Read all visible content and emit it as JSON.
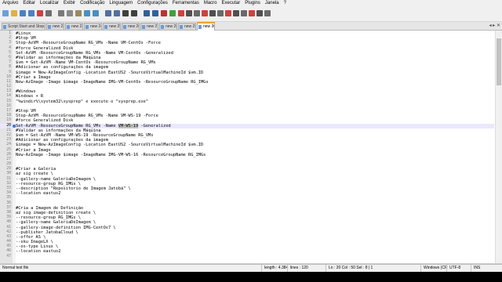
{
  "menu": [
    "Arquivo",
    "Editar",
    "Localizar",
    "Exibir",
    "Codificação",
    "Linguagem",
    "Configurações",
    "Ferramentas",
    "Macro",
    "Executar",
    "Plugins",
    "Janela",
    "?"
  ],
  "tabs": [
    "Script Start and Stop.txt",
    "new 22",
    "new 23",
    "new 24",
    "new 25",
    "new 26",
    "new 27",
    "new 28",
    "new 29",
    "new 30"
  ],
  "active_tab": "new 30",
  "editor": {
    "current_line": 20,
    "lines": [
      "#Linux",
      "#Stop VM",
      "Stop-AzVM -ResourceGroupName RG_VMs -Name VM-CentOs -Force",
      "#force Generalized Disk",
      "Set-AzVM -ResourceGroupName RG_VMs -Name VM-CentOs -Generalized",
      "#Validar as informações da Máquina",
      "$vm = Get-AzVM -Name VM-CentOs -ResourceGroupName RG_VMs",
      "#Adicionar as configurações da imagem",
      "$image = New-AzImageConfig -Location EastUS2 -SourceVirtualMachineId $vm.ID",
      "#Criar a Image",
      "New-AzImage -Image $image -ImageName IMG-VM-CentOs -ResourceGroupName RG_IMGs",
      "",
      "#Windows",
      "Windows + R",
      "\"%windir%\\system32\\sysprep\" e execute o \"sysprep.exe\"",
      "",
      "#Stop VM",
      "Stop-AzVM -ResourceGroupName RG_VMs -Name VM-WS-19 -Force",
      "#force Generalized Disk",
      "Set-AzVM -ResourceGroupName RG_VMs -Name VM-WS-19 -Generalized",
      "#Validar as informações da Máquina",
      "$vm = Get-AzVM -Name VM-WS-19 -ResourceGroupName RG_VMs",
      "#Adicionar as configurações da imagem",
      "$image = New-AzImageConfig -Location EastUS2 -SourceVirtualMachineId $vm.ID",
      "#Criar a Image",
      "New-AzImage -Image $image -ImageName IMG-VM-WS-16 -ResourceGroupName RG_IMGs",
      "",
      "",
      "#Criar a Galeria",
      "az sig create \\",
      "--gallery-name GaleriaDeImagem \\",
      "--resource-group RG_IMGs \\",
      "--description \"Repositorio de Imagem Jatobá\" \\",
      "--location eastus2",
      "",
      "",
      "#Cria a Imagem de Definição",
      "az sig image-definition create \\",
      "--resource-group RG_IMGs \\",
      "--gallery-name GaleriaDeImagem \\",
      "--gallery-image-definition IMG-CentOs7 \\",
      "--publisher JatobaCloud \\",
      "--offer AS \\",
      "--sku ImageLX \\",
      "--os-type Linux \\",
      "--location eastus2",
      ""
    ]
  },
  "status": {
    "type": "Normal text file",
    "length": "length : 4.384",
    "lines": "lines : 120",
    "position": "Ln : 20   Col : 50   Sel : 8 | 1",
    "eol": "Windows (CR LF)",
    "encoding": "UTF-8",
    "mode": "INS"
  },
  "colors": {
    "accent_tab": "#f0a030",
    "current_line": "#e8e8ff"
  },
  "icons": [
    "new-file-icon",
    "open-icon",
    "save-icon",
    "save-all-icon",
    "close-icon",
    "print-icon",
    "cut-icon",
    "copy-icon",
    "paste-icon",
    "undo-icon",
    "redo-icon",
    "find-icon",
    "replace-icon",
    "zoom-in-icon",
    "zoom-out-icon",
    "wrap-icon",
    "indent-guide-icon",
    "record-macro-icon",
    "play-macro-icon"
  ]
}
